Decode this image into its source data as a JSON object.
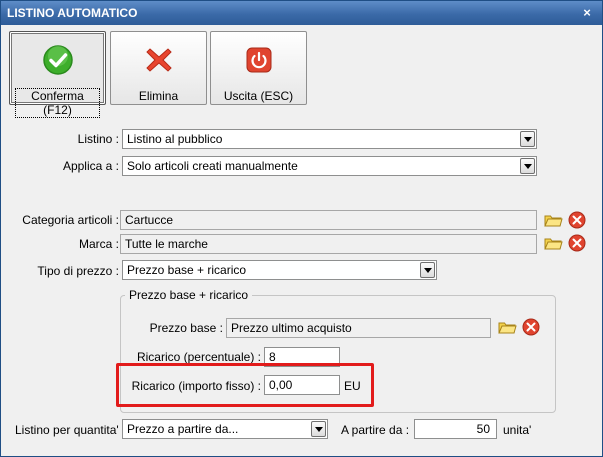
{
  "window": {
    "title": "LISTINO AUTOMATICO",
    "close_glyph": "×"
  },
  "toolbar": {
    "confirm_label": "Conferma (F12)",
    "delete_label": "Elimina",
    "exit_label": "Uscita (ESC)",
    "icons": {
      "confirm": "check-icon",
      "delete": "x-icon",
      "exit": "power-icon"
    }
  },
  "form": {
    "listino": {
      "label": "Listino :",
      "value": "Listino al pubblico"
    },
    "applica": {
      "label": "Applica a :",
      "value": "Solo articoli creati manualmente"
    },
    "categoria": {
      "label": "Categoria articoli :",
      "value": "Cartucce"
    },
    "marca": {
      "label": "Marca :",
      "value": "Tutte le marche"
    },
    "tipo_prezzo": {
      "label": "Tipo di prezzo :",
      "value": "Prezzo base + ricarico"
    }
  },
  "group": {
    "title": "Prezzo base + ricarico",
    "prezzo_base": {
      "label": "Prezzo base :",
      "value": "Prezzo ultimo acquisto"
    },
    "ricarico_perc": {
      "label": "Ricarico (percentuale) :",
      "value": "8"
    },
    "ricarico_fisso": {
      "label": "Ricarico (importo fisso) :",
      "value": "0,00",
      "unit": "EU"
    }
  },
  "bottom": {
    "listino_quantita": {
      "label": "Listino per quantita' :",
      "value": "Prezzo a partire da..."
    },
    "a_partire": {
      "label": "A partire da :",
      "value": "50",
      "unit": "unita'"
    }
  },
  "colors": {
    "highlight": "#e21b1b",
    "title_bar": "#3b6aa8",
    "confirm_green": "#3dae2b",
    "delete_red": "#e8452f"
  }
}
